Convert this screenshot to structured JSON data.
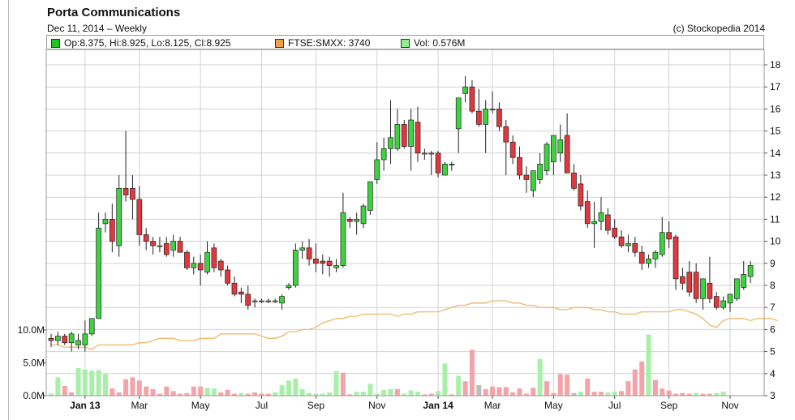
{
  "title": "Porta Communications",
  "subtitle": "Dec 11, 2014  – Weekly",
  "copyright": "(c) Stockopedia 2014",
  "legend": [
    {
      "label": "Op:8.375, Hi:8.925, Lo:8.125, Cl:8.925",
      "color": "#22c322"
    },
    {
      "label": "FTSE:SMXX: 3740",
      "color": "#f0a04b"
    },
    {
      "label": "Vol: 0.576M",
      "color": "#90ee90"
    }
  ],
  "colors": {
    "up": "#3fd23f",
    "down": "#e0383d",
    "line": "#f0b86a",
    "vol_up": "#a8f0a8",
    "vol_down": "#f4a4a8",
    "vol_flat": "#bbbbbb",
    "grid": "#d3d3d3",
    "frame": "#9a9a9a"
  },
  "chart_data": {
    "type": "candlestick",
    "interval": "weekly",
    "price_axis": {
      "side": "right",
      "min": 3,
      "max": 18.5,
      "ticks": [
        "3",
        "4",
        "5",
        "6",
        "7",
        "8",
        "9",
        "10",
        "11",
        "12",
        "13",
        "14",
        "15",
        "16",
        "17",
        "18"
      ]
    },
    "volume_axis": {
      "side": "left",
      "min": 0,
      "max": 12000000,
      "ticks": [
        {
          "value": 0,
          "label": "0.0M"
        },
        {
          "value": 5000000,
          "label": "5.0M"
        },
        {
          "value": 10000000,
          "label": "10.0M"
        }
      ]
    },
    "x_labels": [
      {
        "label": "Jan 13",
        "bold": true,
        "week": 5
      },
      {
        "label": "Mar",
        "bold": false,
        "week": 13
      },
      {
        "label": "May",
        "bold": false,
        "week": 22
      },
      {
        "label": "Jul",
        "bold": false,
        "week": 31
      },
      {
        "label": "Sep",
        "bold": false,
        "week": 39
      },
      {
        "label": "Nov",
        "bold": false,
        "week": 48
      },
      {
        "label": "Jan 14",
        "bold": true,
        "week": 57
      },
      {
        "label": "Mar",
        "bold": false,
        "week": 65
      },
      {
        "label": "May",
        "bold": false,
        "week": 74
      },
      {
        "label": "Jul",
        "bold": false,
        "week": 83
      },
      {
        "label": "Sep",
        "bold": false,
        "week": 91
      },
      {
        "label": "Nov",
        "bold": false,
        "week": 100
      }
    ],
    "candles": [
      {
        "o": 5.6,
        "h": 5.8,
        "l": 5.2,
        "c": 5.5
      },
      {
        "o": 5.5,
        "h": 5.9,
        "l": 5.3,
        "c": 5.7
      },
      {
        "o": 5.7,
        "h": 5.8,
        "l": 5.3,
        "c": 5.4
      },
      {
        "o": 5.4,
        "h": 5.9,
        "l": 5.0,
        "c": 5.8
      },
      {
        "o": 5.3,
        "h": 5.8,
        "l": 5.1,
        "c": 5.5
      },
      {
        "o": 5.3,
        "h": 6.4,
        "l": 5.0,
        "c": 5.8
      },
      {
        "o": 5.8,
        "h": 6.3,
        "l": 5.7,
        "c": 6.5
      },
      {
        "o": 6.5,
        "h": 11.3,
        "l": 6.5,
        "c": 10.6
      },
      {
        "o": 10.8,
        "h": 11.3,
        "l": 10.4,
        "c": 11.0
      },
      {
        "o": 11.0,
        "h": 11.7,
        "l": 9.5,
        "c": 10.0
      },
      {
        "o": 9.8,
        "h": 13.0,
        "l": 9.3,
        "c": 12.4
      },
      {
        "o": 12.4,
        "h": 15.0,
        "l": 11.8,
        "c": 12.1
      },
      {
        "o": 12.4,
        "h": 13.0,
        "l": 11.0,
        "c": 11.9
      },
      {
        "o": 11.9,
        "h": 12.5,
        "l": 9.8,
        "c": 10.3
      },
      {
        "o": 10.3,
        "h": 10.6,
        "l": 9.6,
        "c": 10.0
      },
      {
        "o": 10.0,
        "h": 10.2,
        "l": 9.4,
        "c": 9.8
      },
      {
        "o": 9.8,
        "h": 10.2,
        "l": 9.5,
        "c": 9.8
      },
      {
        "o": 9.9,
        "h": 10.2,
        "l": 9.3,
        "c": 9.4
      },
      {
        "o": 9.6,
        "h": 10.3,
        "l": 9.3,
        "c": 10.0
      },
      {
        "o": 10.0,
        "h": 10.2,
        "l": 9.5,
        "c": 9.5
      },
      {
        "o": 9.5,
        "h": 9.6,
        "l": 8.7,
        "c": 8.8
      },
      {
        "o": 8.8,
        "h": 9.3,
        "l": 8.5,
        "c": 9.0
      },
      {
        "o": 9.0,
        "h": 9.4,
        "l": 8.0,
        "c": 8.7
      },
      {
        "o": 8.6,
        "h": 10.0,
        "l": 8.5,
        "c": 9.5
      },
      {
        "o": 9.7,
        "h": 9.9,
        "l": 8.6,
        "c": 8.8
      },
      {
        "o": 9.1,
        "h": 9.2,
        "l": 8.4,
        "c": 8.7
      },
      {
        "o": 8.7,
        "h": 8.9,
        "l": 8.0,
        "c": 8.1
      },
      {
        "o": 8.1,
        "h": 8.4,
        "l": 7.5,
        "c": 7.6
      },
      {
        "o": 7.7,
        "h": 7.9,
        "l": 7.2,
        "c": 7.6
      },
      {
        "o": 7.6,
        "h": 8.0,
        "l": 6.9,
        "c": 7.1
      },
      {
        "o": 7.3,
        "h": 7.4,
        "l": 7.0,
        "c": 7.3
      },
      {
        "o": 7.3,
        "h": 7.4,
        "l": 7.2,
        "c": 7.3
      },
      {
        "o": 7.3,
        "h": 7.4,
        "l": 7.2,
        "c": 7.3
      },
      {
        "o": 7.3,
        "h": 7.4,
        "l": 7.2,
        "c": 7.3
      },
      {
        "o": 7.2,
        "h": 7.6,
        "l": 6.9,
        "c": 7.5
      },
      {
        "o": 7.9,
        "h": 8.1,
        "l": 7.8,
        "c": 8.0
      },
      {
        "o": 8.0,
        "h": 9.9,
        "l": 7.9,
        "c": 9.6
      },
      {
        "o": 9.6,
        "h": 10.0,
        "l": 9.2,
        "c": 9.7
      },
      {
        "o": 9.7,
        "h": 10.1,
        "l": 8.9,
        "c": 9.2
      },
      {
        "o": 9.2,
        "h": 9.9,
        "l": 8.6,
        "c": 9.0
      },
      {
        "o": 9.1,
        "h": 9.4,
        "l": 8.5,
        "c": 9.0
      },
      {
        "o": 9.1,
        "h": 9.3,
        "l": 8.4,
        "c": 8.9
      },
      {
        "o": 8.8,
        "h": 9.2,
        "l": 8.6,
        "c": 8.9
      },
      {
        "o": 8.9,
        "h": 12.2,
        "l": 8.8,
        "c": 11.3
      },
      {
        "o": 11.0,
        "h": 11.1,
        "l": 10.6,
        "c": 10.9
      },
      {
        "o": 10.9,
        "h": 11.3,
        "l": 10.3,
        "c": 11.0
      },
      {
        "o": 10.8,
        "h": 11.7,
        "l": 10.6,
        "c": 11.6
      },
      {
        "o": 11.4,
        "h": 12.4,
        "l": 11.2,
        "c": 12.7
      },
      {
        "o": 12.8,
        "h": 14.5,
        "l": 12.6,
        "c": 13.7
      },
      {
        "o": 13.7,
        "h": 14.7,
        "l": 13.2,
        "c": 14.2
      },
      {
        "o": 14.2,
        "h": 16.4,
        "l": 13.5,
        "c": 14.7
      },
      {
        "o": 14.2,
        "h": 16.0,
        "l": 14.1,
        "c": 15.3
      },
      {
        "o": 15.3,
        "h": 15.5,
        "l": 14.2,
        "c": 14.3
      },
      {
        "o": 14.3,
        "h": 16.0,
        "l": 13.2,
        "c": 15.5
      },
      {
        "o": 15.4,
        "h": 16.1,
        "l": 13.6,
        "c": 14.0
      },
      {
        "o": 14.0,
        "h": 14.2,
        "l": 13.7,
        "c": 14.0
      },
      {
        "o": 14.0,
        "h": 14.1,
        "l": 13.0,
        "c": 14.0
      },
      {
        "o": 14.0,
        "h": 14.1,
        "l": 12.9,
        "c": 13.1
      },
      {
        "o": 13.0,
        "h": 13.6,
        "l": 13.0,
        "c": 13.5
      },
      {
        "o": 13.5,
        "h": 13.6,
        "l": 13.2,
        "c": 13.5
      },
      {
        "o": 15.1,
        "h": 16.3,
        "l": 14.0,
        "c": 16.5
      },
      {
        "o": 16.7,
        "h": 17.5,
        "l": 16.3,
        "c": 17.0
      },
      {
        "o": 17.0,
        "h": 17.3,
        "l": 15.8,
        "c": 15.9
      },
      {
        "o": 15.9,
        "h": 16.9,
        "l": 15.2,
        "c": 15.3
      },
      {
        "o": 15.3,
        "h": 16.4,
        "l": 14.0,
        "c": 16.0
      },
      {
        "o": 16.0,
        "h": 16.8,
        "l": 15.8,
        "c": 16.0
      },
      {
        "o": 16.0,
        "h": 16.3,
        "l": 15.0,
        "c": 15.2
      },
      {
        "o": 15.2,
        "h": 15.5,
        "l": 13.0,
        "c": 14.5
      },
      {
        "o": 14.5,
        "h": 14.8,
        "l": 13.5,
        "c": 13.8
      },
      {
        "o": 13.8,
        "h": 14.3,
        "l": 12.8,
        "c": 13.0
      },
      {
        "o": 13.0,
        "h": 13.4,
        "l": 12.2,
        "c": 12.8
      },
      {
        "o": 12.3,
        "h": 13.0,
        "l": 12.0,
        "c": 13.2
      },
      {
        "o": 12.8,
        "h": 14.0,
        "l": 12.6,
        "c": 13.5
      },
      {
        "o": 13.2,
        "h": 14.5,
        "l": 13.0,
        "c": 14.4
      },
      {
        "o": 13.6,
        "h": 14.7,
        "l": 13.0,
        "c": 14.8
      },
      {
        "o": 14.0,
        "h": 15.3,
        "l": 13.6,
        "c": 14.6
      },
      {
        "o": 14.8,
        "h": 15.8,
        "l": 13.1,
        "c": 13.1
      },
      {
        "o": 13.1,
        "h": 13.5,
        "l": 12.3,
        "c": 12.4
      },
      {
        "o": 12.6,
        "h": 13.0,
        "l": 11.4,
        "c": 11.6
      },
      {
        "o": 11.8,
        "h": 12.3,
        "l": 10.6,
        "c": 10.8
      },
      {
        "o": 10.8,
        "h": 11.8,
        "l": 9.7,
        "c": 10.9
      },
      {
        "o": 10.9,
        "h": 12.0,
        "l": 10.5,
        "c": 11.3
      },
      {
        "o": 11.2,
        "h": 11.5,
        "l": 10.3,
        "c": 10.5
      },
      {
        "o": 10.6,
        "h": 11.0,
        "l": 10.1,
        "c": 10.2
      },
      {
        "o": 10.2,
        "h": 10.5,
        "l": 9.7,
        "c": 9.8
      },
      {
        "o": 9.8,
        "h": 10.3,
        "l": 9.5,
        "c": 9.9
      },
      {
        "o": 9.9,
        "h": 10.2,
        "l": 9.3,
        "c": 9.5
      },
      {
        "o": 9.5,
        "h": 9.8,
        "l": 8.7,
        "c": 9.0
      },
      {
        "o": 9.0,
        "h": 9.4,
        "l": 8.8,
        "c": 9.2
      },
      {
        "o": 9.2,
        "h": 9.6,
        "l": 8.8,
        "c": 9.5
      },
      {
        "o": 9.4,
        "h": 11.1,
        "l": 9.3,
        "c": 10.4
      },
      {
        "o": 10.4,
        "h": 10.9,
        "l": 9.7,
        "c": 10.1
      },
      {
        "o": 10.2,
        "h": 10.3,
        "l": 7.8,
        "c": 8.3
      },
      {
        "o": 8.4,
        "h": 8.8,
        "l": 7.8,
        "c": 8.1
      },
      {
        "o": 8.6,
        "h": 9.1,
        "l": 7.5,
        "c": 7.7
      },
      {
        "o": 8.6,
        "h": 9.0,
        "l": 7.2,
        "c": 7.4
      },
      {
        "o": 7.4,
        "h": 8.2,
        "l": 6.9,
        "c": 8.3
      },
      {
        "o": 8.1,
        "h": 9.3,
        "l": 7.2,
        "c": 7.4
      },
      {
        "o": 7.5,
        "h": 7.7,
        "l": 6.9,
        "c": 7.0
      },
      {
        "o": 7.0,
        "h": 7.5,
        "l": 6.9,
        "c": 7.3
      },
      {
        "o": 7.2,
        "h": 7.6,
        "l": 6.8,
        "c": 7.6
      },
      {
        "o": 7.4,
        "h": 8.3,
        "l": 7.3,
        "c": 8.3
      },
      {
        "o": 7.9,
        "h": 9.1,
        "l": 7.8,
        "c": 8.5
      },
      {
        "o": 8.4,
        "h": 9.1,
        "l": 8.1,
        "c": 8.9
      }
    ],
    "index_series": {
      "name": "FTSE:SMXX",
      "values": [
        5.3,
        5.3,
        5.2,
        5.2,
        5.2,
        5.2,
        5.1,
        5.3,
        5.3,
        5.3,
        5.3,
        5.3,
        5.3,
        5.4,
        5.4,
        5.5,
        5.6,
        5.6,
        5.6,
        5.5,
        5.5,
        5.5,
        5.6,
        5.6,
        5.6,
        5.8,
        5.8,
        5.8,
        5.8,
        5.8,
        5.8,
        5.7,
        5.6,
        5.6,
        5.7,
        5.9,
        5.9,
        6.0,
        6.0,
        6.1,
        6.3,
        6.4,
        6.5,
        6.5,
        6.6,
        6.6,
        6.7,
        6.7,
        6.7,
        6.7,
        6.7,
        6.6,
        6.7,
        6.7,
        6.8,
        6.8,
        6.8,
        6.8,
        6.9,
        7.0,
        7.1,
        7.1,
        7.2,
        7.2,
        7.2,
        7.3,
        7.3,
        7.3,
        7.2,
        7.2,
        7.1,
        7.1,
        7.0,
        7.0,
        7.0,
        6.9,
        6.9,
        7.0,
        7.0,
        7.0,
        6.9,
        6.9,
        6.8,
        6.8,
        6.7,
        6.7,
        6.7,
        6.8,
        6.8,
        6.8,
        6.8,
        6.8,
        6.9,
        6.9,
        6.8,
        6.7,
        6.5,
        6.2,
        6.1,
        6.4,
        6.5,
        6.5,
        6.5,
        6.4,
        6.5,
        6.5,
        6.5,
        6.4
      ]
    },
    "volumes": [
      0.3,
      2.8,
      1.5,
      0.5,
      4.2,
      4.0,
      3.8,
      3.9,
      3.3,
      1.1,
      0.5,
      2.5,
      2.8,
      2.3,
      1.4,
      1.0,
      0.3,
      1.4,
      0.7,
      0.3,
      0.4,
      1.4,
      1.4,
      1.2,
      1.1,
      0.5,
      0.9,
      0.3,
      0.4,
      0.3,
      0.5,
      0.3,
      0.3,
      0.5,
      1.6,
      2.3,
      2.6,
      1.0,
      0.4,
      0.3,
      0.3,
      0.5,
      3.7,
      3.5,
      0.2,
      0.6,
      0.6,
      1.8,
      0.3,
      0.9,
      1.0,
      1.0,
      0.3,
      0.8,
      0.6,
      0.2,
      0.3,
      0.7,
      4.9,
      0.2,
      3.0,
      2.2,
      7.0,
      1.6,
      1.0,
      1.4,
      1.3,
      1.3,
      0.5,
      1.1,
      0.3,
      1.2,
      5.6,
      2.2,
      0.4,
      3.3,
      3.2,
      0.4,
      0.6,
      2.6,
      0.6,
      0.6,
      0.5,
      0.6,
      0.7,
      2.2,
      4.0,
      5.2,
      9.3,
      2.4,
      1.1,
      0.8,
      0.3,
      0.4,
      0.3,
      0.4,
      0.3,
      0.3,
      0.4,
      0.6
    ],
    "volume_dir": [
      "u",
      "u",
      "d",
      "d",
      "u",
      "u",
      "u",
      "u",
      "u",
      "d",
      "d",
      "d",
      "d",
      "d",
      "d",
      "d",
      "d",
      "d",
      "d",
      "d",
      "d",
      "d",
      "d",
      "u",
      "u",
      "d",
      "d",
      "d",
      "u",
      "d",
      "d",
      "d",
      "d",
      "u",
      "u",
      "u",
      "u",
      "u",
      "u",
      "u",
      "u",
      "u",
      "u",
      "d",
      "d",
      "u",
      "u",
      "u",
      "u",
      "u",
      "u",
      "d",
      "u",
      "u",
      "u",
      "d",
      "d",
      "u",
      "u",
      "d",
      "u",
      "d",
      "d",
      "f",
      "d",
      "d",
      "d",
      "d",
      "d",
      "d",
      "d",
      "d",
      "u",
      "d",
      "d",
      "d",
      "d",
      "f",
      "u",
      "d",
      "d",
      "d",
      "u",
      "u",
      "d",
      "d",
      "d",
      "d",
      "u",
      "d",
      "d",
      "d",
      "d",
      "d",
      "d",
      "u",
      "d",
      "d",
      "u",
      "u"
    ]
  }
}
